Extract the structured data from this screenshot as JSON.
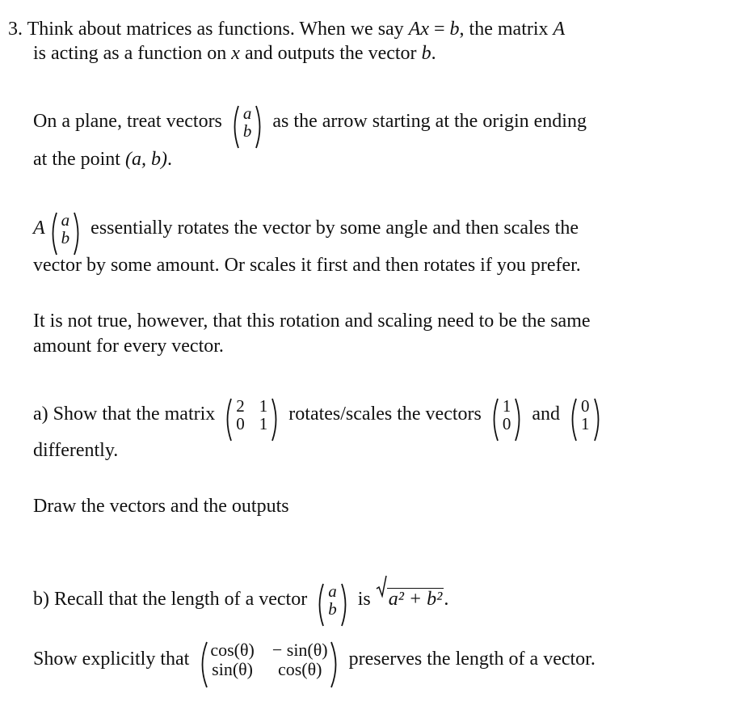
{
  "problem": {
    "number": "3.",
    "intro_line1_a": "Think about matrices as functions. When we say ",
    "intro_eq_lhs": "Ax",
    "intro_eq_op": "=",
    "intro_eq_rhs": "b",
    "intro_line1_b": ", the matrix ",
    "intro_line1_var": "A",
    "intro_line2_a": "is acting as a function on ",
    "intro_line2_var": "x",
    "intro_line2_b": " and outputs the vector ",
    "intro_line2_var2": "b",
    "intro_line2_end": "."
  },
  "para_plane": {
    "text_a": "On a plane, treat vectors",
    "vector": [
      "a",
      "b"
    ],
    "text_b": "as the arrow starting at the origin ending",
    "line2_a": "at the point ",
    "point": "(a, b)",
    "line2_end": "."
  },
  "para_rotate": {
    "matrix_var": "A",
    "vector": [
      "a",
      "b"
    ],
    "text_a": "essentially rotates the vector by some angle and then scales the",
    "line2": "vector by some amount. Or scales it first and then rotates if you prefer."
  },
  "para_not_true": {
    "line1": "It is not true, however, that this rotation and scaling need to be the same",
    "line2": "amount for every vector."
  },
  "part_a": {
    "text_a": "a) Show that the matrix",
    "matrix": [
      [
        "2",
        "1"
      ],
      [
        "0",
        "1"
      ]
    ],
    "text_b": "rotates/scales the vectors",
    "vector1": [
      "1",
      "0"
    ],
    "and": "and",
    "vector2": [
      "0",
      "1"
    ],
    "line2": "differently.",
    "draw": "Draw the vectors and the outputs"
  },
  "part_b": {
    "text_a": "b) Recall that the length of a vector",
    "vector": [
      "a",
      "b"
    ],
    "is": "is",
    "sqrt_expr": "a² + b²",
    "end": ".",
    "show_a": "Show explicitly that",
    "matrix": [
      [
        "cos(θ)",
        "− sin(θ)"
      ],
      [
        "sin(θ)",
        "cos(θ)"
      ]
    ],
    "show_b": "preserves the length of a vector."
  }
}
